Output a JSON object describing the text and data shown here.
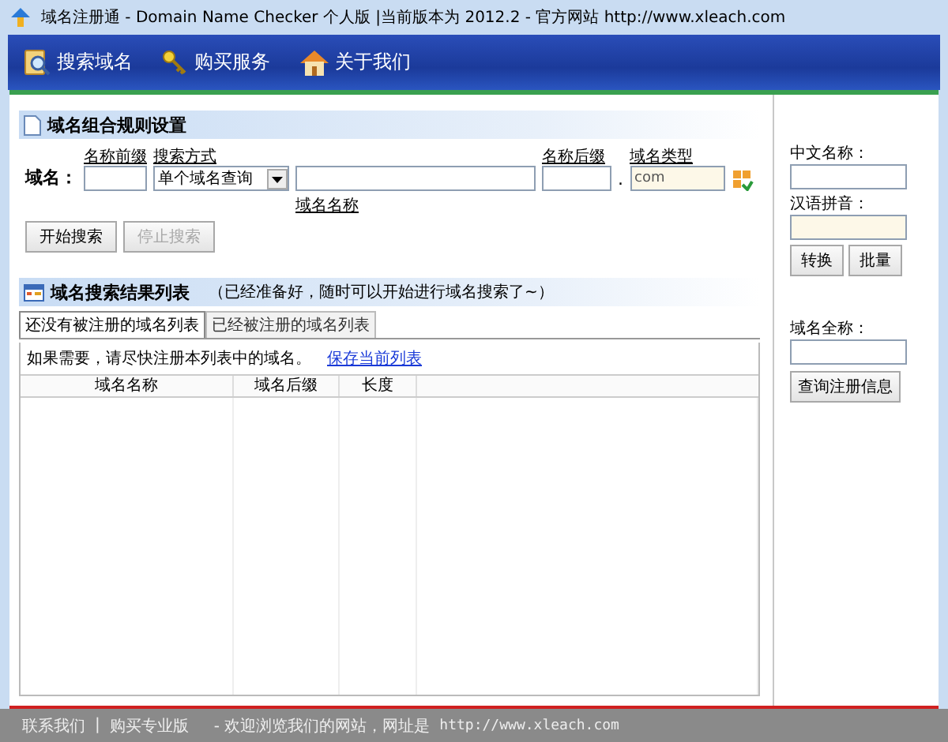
{
  "window": {
    "title": "域名注册通 - Domain Name Checker 个人版 |当前版本为 2012.2  - 官方网站 http://www.xleach.com"
  },
  "toolbar": [
    {
      "label": "搜索域名",
      "kind": "search"
    },
    {
      "label": "购买服务",
      "kind": "key"
    },
    {
      "label": "关于我们",
      "kind": "home"
    }
  ],
  "rule_settings": {
    "title": "域名组合规则设置",
    "domain_label": "域名：",
    "prefix_label": "名称前缀",
    "search_mode_label": "搜索方式",
    "search_mode_value": "单个域名查询",
    "name_label": "域名名称",
    "suffix_label": "名称后缀",
    "dot": ".",
    "type_label": "域名类型",
    "type_value": "com",
    "buttons": [
      {
        "label": "开始搜索",
        "disabled": false
      },
      {
        "label": "停止搜索",
        "disabled": true
      }
    ]
  },
  "results": {
    "title": "域名搜索结果列表",
    "note": "（已经准备好，随时可以开始进行域名搜索了~）",
    "tabs": [
      {
        "label": "还没有被注册的域名列表",
        "selected": true
      },
      {
        "label": "已经被注册的域名列表",
        "selected": false
      }
    ],
    "hint": "如果需要，请尽快注册本列表中的域名。",
    "save_link": "保存当前列表",
    "columns": [
      "域名名称",
      "域名后缀",
      "长度"
    ]
  },
  "side": {
    "chinese_name_label": "中文名称：",
    "pinyin_label": "汉语拼音：",
    "buttons": [
      "转换",
      "批量"
    ],
    "full_name_label": "域名全称：",
    "query_button": "查询注册信息"
  },
  "status_bar": {
    "links": [
      "联系我们",
      "购买专业版"
    ],
    "separator": "|",
    "message": "- 欢迎浏览我们的网站，网址是",
    "url": "http://www.xleach.com"
  }
}
